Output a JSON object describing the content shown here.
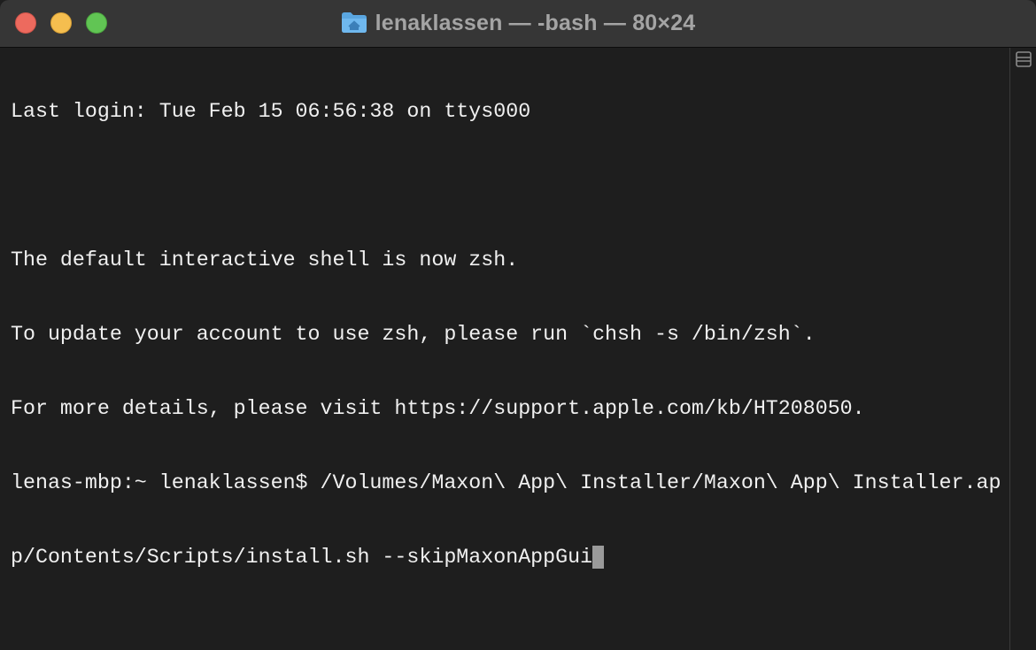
{
  "window": {
    "title": "lenaklassen — -bash — 80×24",
    "icons": {
      "title": "home-folder-icon",
      "split": "split-pane-icon"
    },
    "colors": {
      "background": "#1e1e1e",
      "titlebar": "#363636",
      "text": "#f0f0f0",
      "cursor": "#9a9a9a",
      "close": "#ed6a5e",
      "minimize": "#f5be4f",
      "maximize": "#61c554"
    }
  },
  "terminal": {
    "lines": [
      "Last login: Tue Feb 15 06:56:38 on ttys000",
      "",
      "The default interactive shell is now zsh.",
      "To update your account to use zsh, please run `chsh -s /bin/zsh`.",
      "For more details, please visit https://support.apple.com/kb/HT208050.",
      "lenas-mbp:~ lenaklassen$ /Volumes/Maxon\\ App\\ Installer/Maxon\\ App\\ Installer.ap",
      "p/Contents/Scripts/install.sh --skipMaxonAppGui"
    ]
  }
}
